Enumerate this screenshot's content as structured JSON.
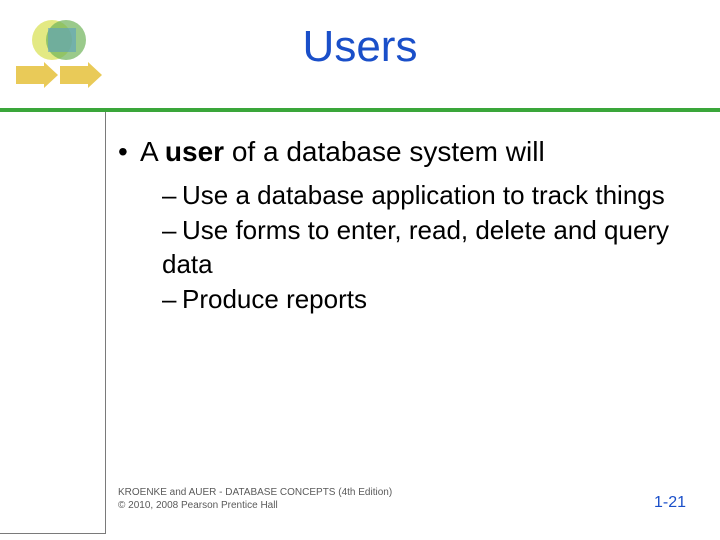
{
  "title": "Users",
  "main_bullet": {
    "prefix": "A ",
    "bold": "user",
    "suffix": " of a database system will"
  },
  "sub_bullets": [
    "Use a database application to track things",
    "Use forms to enter, read, delete and query data",
    "Produce reports"
  ],
  "footer": {
    "line1": "KROENKE and AUER - DATABASE CONCEPTS (4th Edition)",
    "line2": "© 2010, 2008 Pearson Prentice Hall"
  },
  "page_number": "1-21"
}
